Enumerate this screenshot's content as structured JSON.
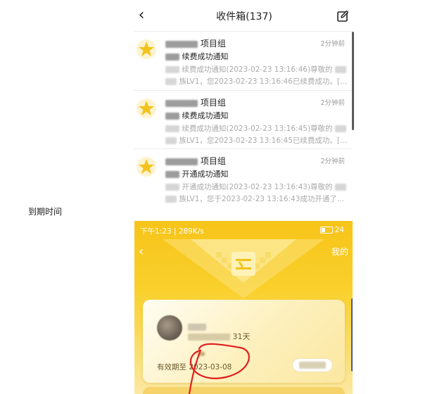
{
  "inbox": {
    "title": "收件箱(137)",
    "messages": [
      {
        "title_suffix": "项目组",
        "time": "2分钟前",
        "subject": "续费成功通知",
        "line1": "续费成功通知(2023-02-23 13:16:46)尊敬的",
        "line2": "族LV1，您2023-02-23 13:16:46已续费成功。[..."
      },
      {
        "title_suffix": "项目组",
        "time": "2分钟前",
        "subject": "续费成功通知",
        "line1": "续费成功通知(2023-02-23 13:16:45)尊敬的",
        "line2": "族LV1，您2023-02-23 13:16:45已续费成功。[..."
      },
      {
        "title_suffix": "项目组",
        "time": "2分钟前",
        "subject": "开通成功通知",
        "line1": "开通成功通知(2023-02-23 13:16:43)尊敬的",
        "line2": "族LV1，您于2023-02-23 13:16:43成功开通了..."
      }
    ]
  },
  "caption": "到期时间",
  "member": {
    "status_left": "下午1:23 | 289K/s",
    "status_right": "24",
    "top_right_link": "我的",
    "days_suffix": "31天",
    "expire_label": "有效期至",
    "expire_date": "2023-03-08"
  },
  "colors": {
    "accent_yellow": "#f9d02c",
    "annotation_red": "#e02020",
    "star": "#f3c21b"
  },
  "icons": [
    "back-icon",
    "compose-icon",
    "star-icon",
    "battery-icon"
  ]
}
